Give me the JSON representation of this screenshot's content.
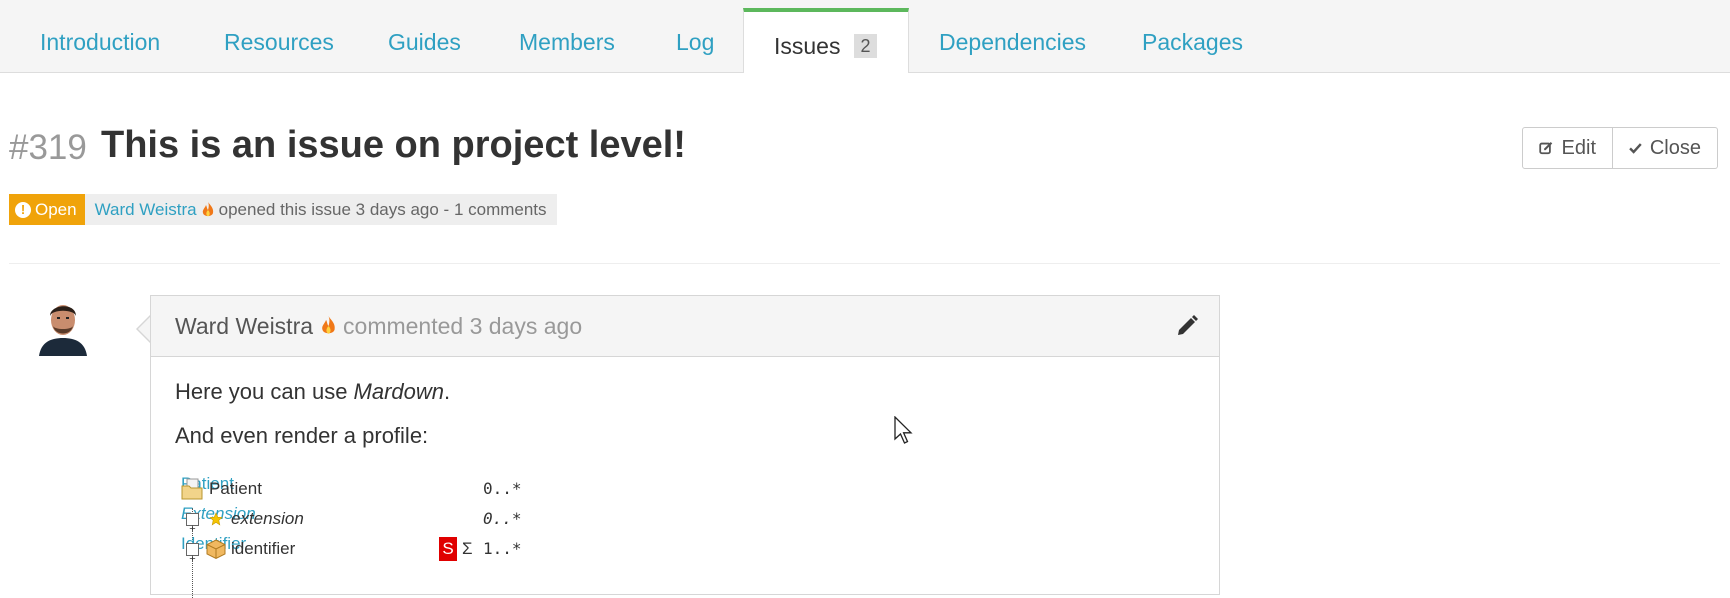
{
  "tabs": [
    {
      "label": "Introduction"
    },
    {
      "label": "Resources"
    },
    {
      "label": "Guides"
    },
    {
      "label": "Members"
    },
    {
      "label": "Log"
    },
    {
      "label": "Issues",
      "count": "2",
      "active": true
    },
    {
      "label": "Dependencies"
    },
    {
      "label": "Packages"
    }
  ],
  "issue": {
    "number": "#319",
    "title": "This is an issue on project level!",
    "status": "Open",
    "author": "Ward Weistra",
    "opened_text": "opened this issue 3 days ago - 1 comments"
  },
  "actions": {
    "edit_label": "Edit",
    "close_label": "Close"
  },
  "comment": {
    "author": "Ward Weistra",
    "when": "commented 3 days ago",
    "body_prefix": "Here you can use ",
    "body_emphasis": "Mardown",
    "body_suffix": ".",
    "body_line2": "And even render a profile:",
    "profile": {
      "root": {
        "name": "Patient",
        "card": "0..*",
        "type": "Patient"
      },
      "rows": [
        {
          "name": "extension",
          "card": "0..*",
          "type": "Extension",
          "italic": true
        },
        {
          "name": "identifier",
          "flags": [
            "S",
            "Σ"
          ],
          "card": "1..*",
          "type": "Identifier"
        }
      ]
    }
  },
  "colors": {
    "link": "#2fa0c2",
    "active_tab_accent": "#5cb85c",
    "status_open": "#f0a30a",
    "must_support_flag": "#e00000"
  }
}
